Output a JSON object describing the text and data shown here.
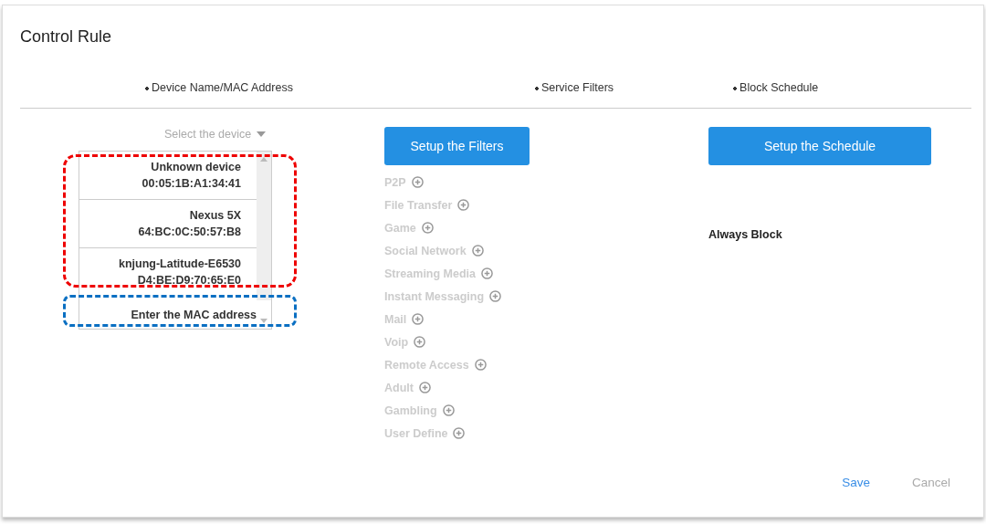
{
  "dialog": {
    "title": "Control Rule"
  },
  "steps": [
    "Device Name/MAC Address",
    "Service Filters",
    "Block Schedule"
  ],
  "device_select": {
    "placeholder": "Select the device"
  },
  "devices": [
    {
      "name": "Unknown device",
      "mac": "00:05:1B:A1:34:41"
    },
    {
      "name": "Nexus 5X",
      "mac": "64:BC:0C:50:57:B8"
    },
    {
      "name": "knjung-Latitude-E6530",
      "mac": "D4:BE:D9:70:65:E0"
    }
  ],
  "mac_entry": {
    "placeholder": "Enter the MAC address"
  },
  "filters_button": "Setup the Filters",
  "filters": [
    {
      "label": "P2P",
      "disabled": true
    },
    {
      "label": "File Transfer",
      "disabled": true
    },
    {
      "label": "Game",
      "disabled": true
    },
    {
      "label": "Social Network",
      "disabled": true
    },
    {
      "label": "Streaming Media",
      "disabled": true
    },
    {
      "label": "Instant Messaging",
      "disabled": true
    },
    {
      "label": "Mail",
      "disabled": true
    },
    {
      "label": "Voip",
      "disabled": true
    },
    {
      "label": "Remote Access",
      "disabled": true
    },
    {
      "label": "Adult",
      "disabled": true
    },
    {
      "label": "Gambling",
      "disabled": true
    },
    {
      "label": "User Define",
      "disabled": true
    }
  ],
  "schedule_button": "Setup the Schedule",
  "schedule": "Always Block",
  "actions": {
    "save": "Save",
    "cancel": "Cancel"
  }
}
